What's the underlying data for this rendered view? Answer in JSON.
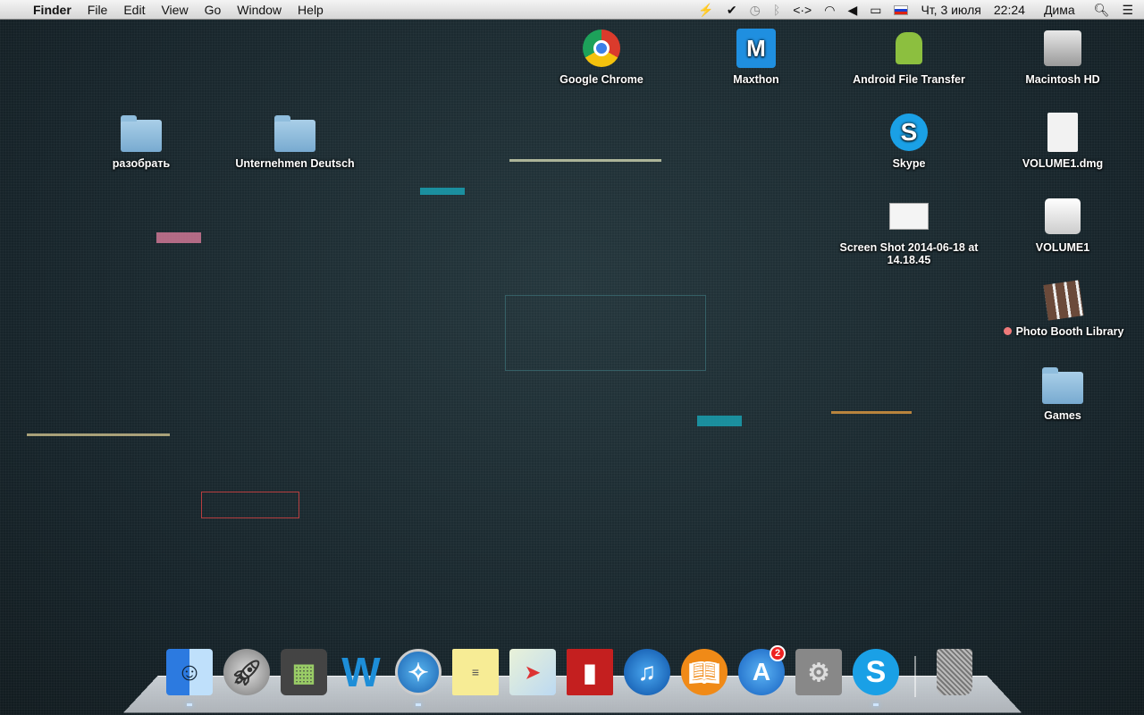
{
  "menubar": {
    "apple": "",
    "app": "Finder",
    "menus": [
      "File",
      "Edit",
      "View",
      "Go",
      "Window",
      "Help"
    ],
    "status": {
      "language_flag": "russian-flag",
      "date": "Чт, 3 июля",
      "time": "22:24",
      "user": "Дима"
    }
  },
  "desktop": {
    "icons": [
      {
        "label": "Google Chrome"
      },
      {
        "label": "Maxthon"
      },
      {
        "label": "Android File Transfer"
      },
      {
        "label": "Macintosh HD"
      },
      {
        "label": "разобрать"
      },
      {
        "label": "Unternehmen Deutsch"
      },
      {
        "label": "Skype"
      },
      {
        "label": "VOLUME1.dmg"
      },
      {
        "label": "Screen Shot 2014-06-18 at 14.18.45"
      },
      {
        "label": "VOLUME1"
      },
      {
        "label": "Photo Booth Library"
      },
      {
        "label": "Games"
      }
    ]
  },
  "dock": {
    "items": [
      "Finder",
      "Launchpad",
      "Mission Control",
      "Word",
      "Safari",
      "Stickies",
      "Maps",
      "Photo Booth",
      "iTunes",
      "iBooks",
      "App Store",
      "System Preferences",
      "Skype",
      "Trash"
    ],
    "app_store_badge": "2"
  }
}
